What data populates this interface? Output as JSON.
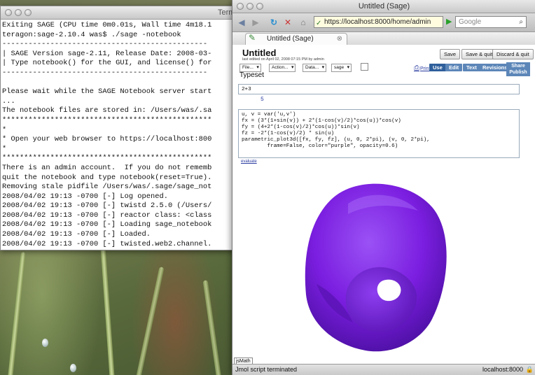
{
  "terminal": {
    "title": "Term",
    "lines": [
      "Exiting SAGE (CPU time 0m0.01s, Wall time 4m18.1",
      "teragon:sage-2.10.4 was$ ./sage -notebook",
      "-----------------------------------------------",
      "| SAGE Version sage-2.11, Release Date: 2008-03-",
      "| Type notebook() for the GUI, and license() for",
      "-----------------------------------------------",
      "",
      "Please wait while the SAGE Notebook server start",
      "...",
      "The notebook files are stored in: /Users/was/.sa",
      "************************************************",
      "*",
      "* Open your web browser to https://localhost:800",
      "*",
      "************************************************",
      "There is an admin account.  If you do not rememb",
      "quit the notebook and type notebook(reset=True).",
      "Removing stale pidfile /Users/was/.sage/sage_not",
      "2008/04/02 19:13 -0700 [-] Log opened.",
      "2008/04/02 19:13 -0700 [-] twistd 2.5.0 (/Users/",
      "2008/04/02 19:13 -0700 [-] reactor class: <class",
      "2008/04/02 19:13 -0700 [-] Loading sage_notebook",
      "2008/04/02 19:13 -0700 [-] Loaded.",
      "2008/04/02 19:13 -0700 [-] twisted.web2.channel.",
      "2008/04/02 19:13 -0700 [-] Starting factory <twi"
    ]
  },
  "browser": {
    "title": "Untitled (Sage)",
    "url": "https://localhost:8000/home/admin",
    "search_placeholder": "Google",
    "tab_label": "Untitled (Sage)",
    "status_left": "Jmol script terminated",
    "status_right": "localhost:8000"
  },
  "worksheet": {
    "title": "Untitled",
    "edited": "last edited on April 02, 2008 07:15 PM by admin",
    "buttons": {
      "save": "Save",
      "save_quit": "Save & quit",
      "discard_quit": "Discard & quit"
    },
    "selects": {
      "file": "File...",
      "action": "Action...",
      "data": "Data...",
      "system": "sage"
    },
    "typeset": "Typeset",
    "print": "Print",
    "tabs": [
      "Use",
      "Edit",
      "Text",
      "Revisions"
    ],
    "share_line1": "Share",
    "share_line2": "Publish",
    "cell1_input": "2+3",
    "cell1_output": "5",
    "cell2_input": "u, v = var('u,v')\nfx = (3*(1+sin(v)) + 2*(1-cos(v)/2)*cos(u))*cos(v)\nfy = (4+2*(1-cos(v)/2)*cos(u))*sin(v)\nfz = -2*(1-cos(v)/2) * sin(u)\nparametric_plot3d([fx, fy, fz], (u, 0, 2*pi), (v, 0, 2*pi),\n        frame=False, color=\"purple\", opacity=0.6)",
    "evaluate": "evaluate",
    "jsmath": "jsMath",
    "plot_color": "#7b1ee0"
  }
}
